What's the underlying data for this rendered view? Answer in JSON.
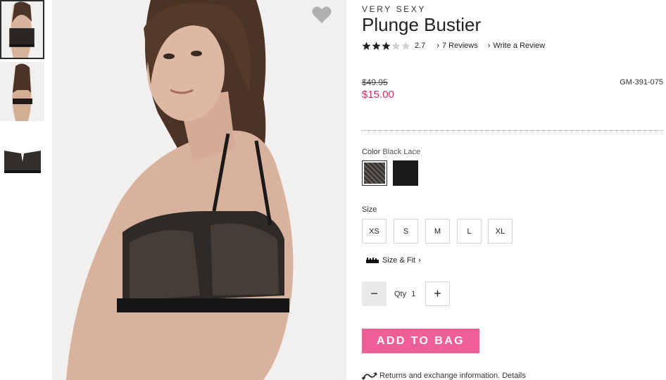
{
  "product": {
    "brand": "VERY SEXY",
    "title": "Plunge Bustier",
    "rating": 2.7,
    "rating_text": "2.7",
    "stars_filled": 3,
    "stars_total": 5,
    "reviews_label": "7 Reviews",
    "write_review_label": "Write a Review",
    "price_original": "$49.95",
    "price_sale": "$15.00",
    "sku": "GM-391-075"
  },
  "color": {
    "label": "Color",
    "selected": "Black Lace",
    "swatches": [
      {
        "name": "Black Lace",
        "hex": "#3a3634"
      },
      {
        "name": "Black",
        "hex": "#1a1a1a"
      }
    ]
  },
  "size": {
    "label": "Size",
    "options": [
      "XS",
      "S",
      "M",
      "L",
      "XL"
    ],
    "fit_label": "Size & Fit"
  },
  "quantity": {
    "label": "Qty",
    "value": "1",
    "minus": "−",
    "plus": "+"
  },
  "cart": {
    "add_label": "ADD TO BAG"
  },
  "returns": {
    "text": "Returns and exchange information.",
    "link": "Details"
  },
  "icons": {
    "favorite": "heart-icon",
    "rating": "star-icon",
    "size_fit": "ruler-icon",
    "returns": "return-arrow-icon",
    "chevron": "chevron-right-icon"
  },
  "colors": {
    "accent": "#ee5f97",
    "sale_price": "#d62b69",
    "heart": "#b0b0b0"
  }
}
